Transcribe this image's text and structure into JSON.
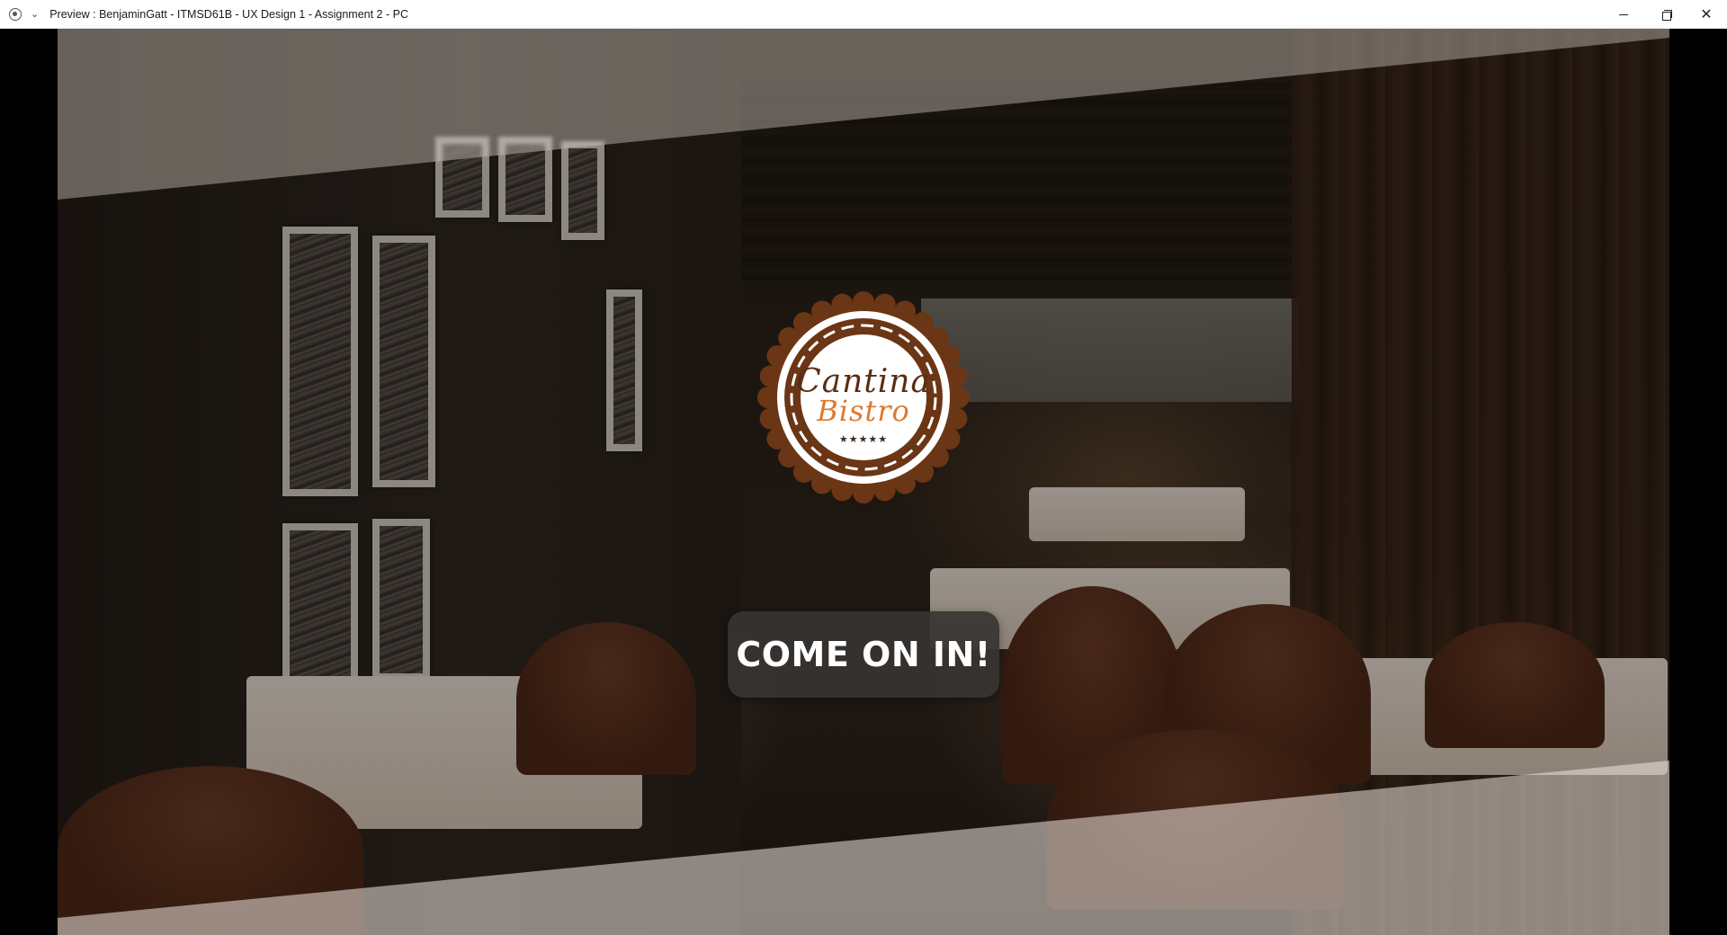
{
  "window": {
    "title": "Preview : BenjaminGatt - ITMSD61B - UX Design 1 - Assignment 2 - PC",
    "controls": [
      "minimize-icon",
      "restore-icon",
      "close-icon"
    ]
  },
  "hero": {
    "logo": {
      "line1": "Cantina",
      "line2": "Bistro",
      "stars": "★★★★★",
      "colors": {
        "ring": "#6b3615",
        "accent": "#e0792d",
        "inner": "#ffffff"
      }
    },
    "cta_label": "COME ON IN!"
  }
}
